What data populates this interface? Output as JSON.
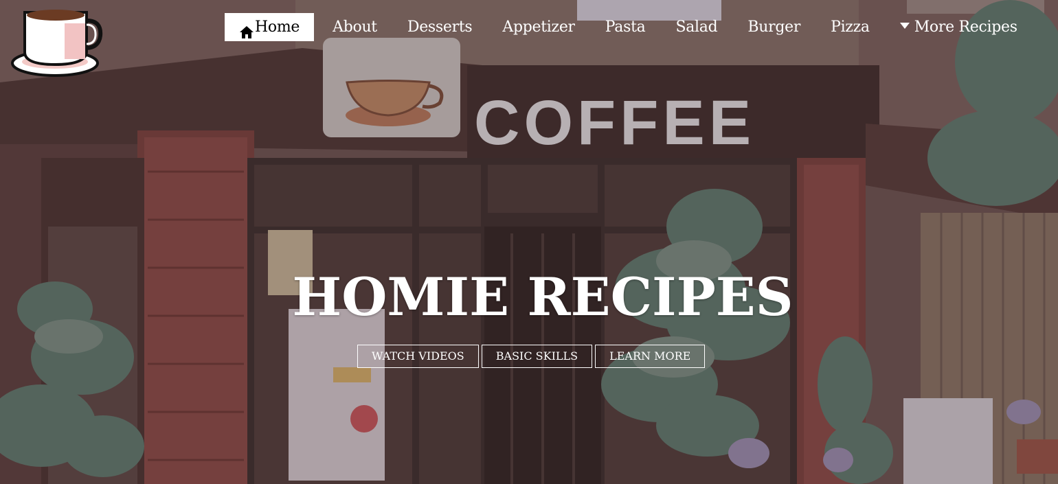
{
  "nav": {
    "items": [
      {
        "label": "Home",
        "icon": "home-icon",
        "active": true
      },
      {
        "label": "About"
      },
      {
        "label": "Desserts"
      },
      {
        "label": "Appetizer"
      },
      {
        "label": "Pasta"
      },
      {
        "label": "Salad"
      },
      {
        "label": "Burger"
      },
      {
        "label": "Pizza"
      }
    ],
    "more": {
      "label": "More Recipes",
      "icon": "caret-down-icon"
    }
  },
  "hero": {
    "title": "HOMIE RECIPES",
    "sign_text": "COFFEE",
    "buttons": [
      "WATCH VIDEOS",
      "BASIC SKILLS",
      "LEARN MORE"
    ]
  },
  "colors": {
    "nav_text": "#ffffff",
    "active_bg": "#ffffff",
    "overlay": "#4a3332"
  }
}
